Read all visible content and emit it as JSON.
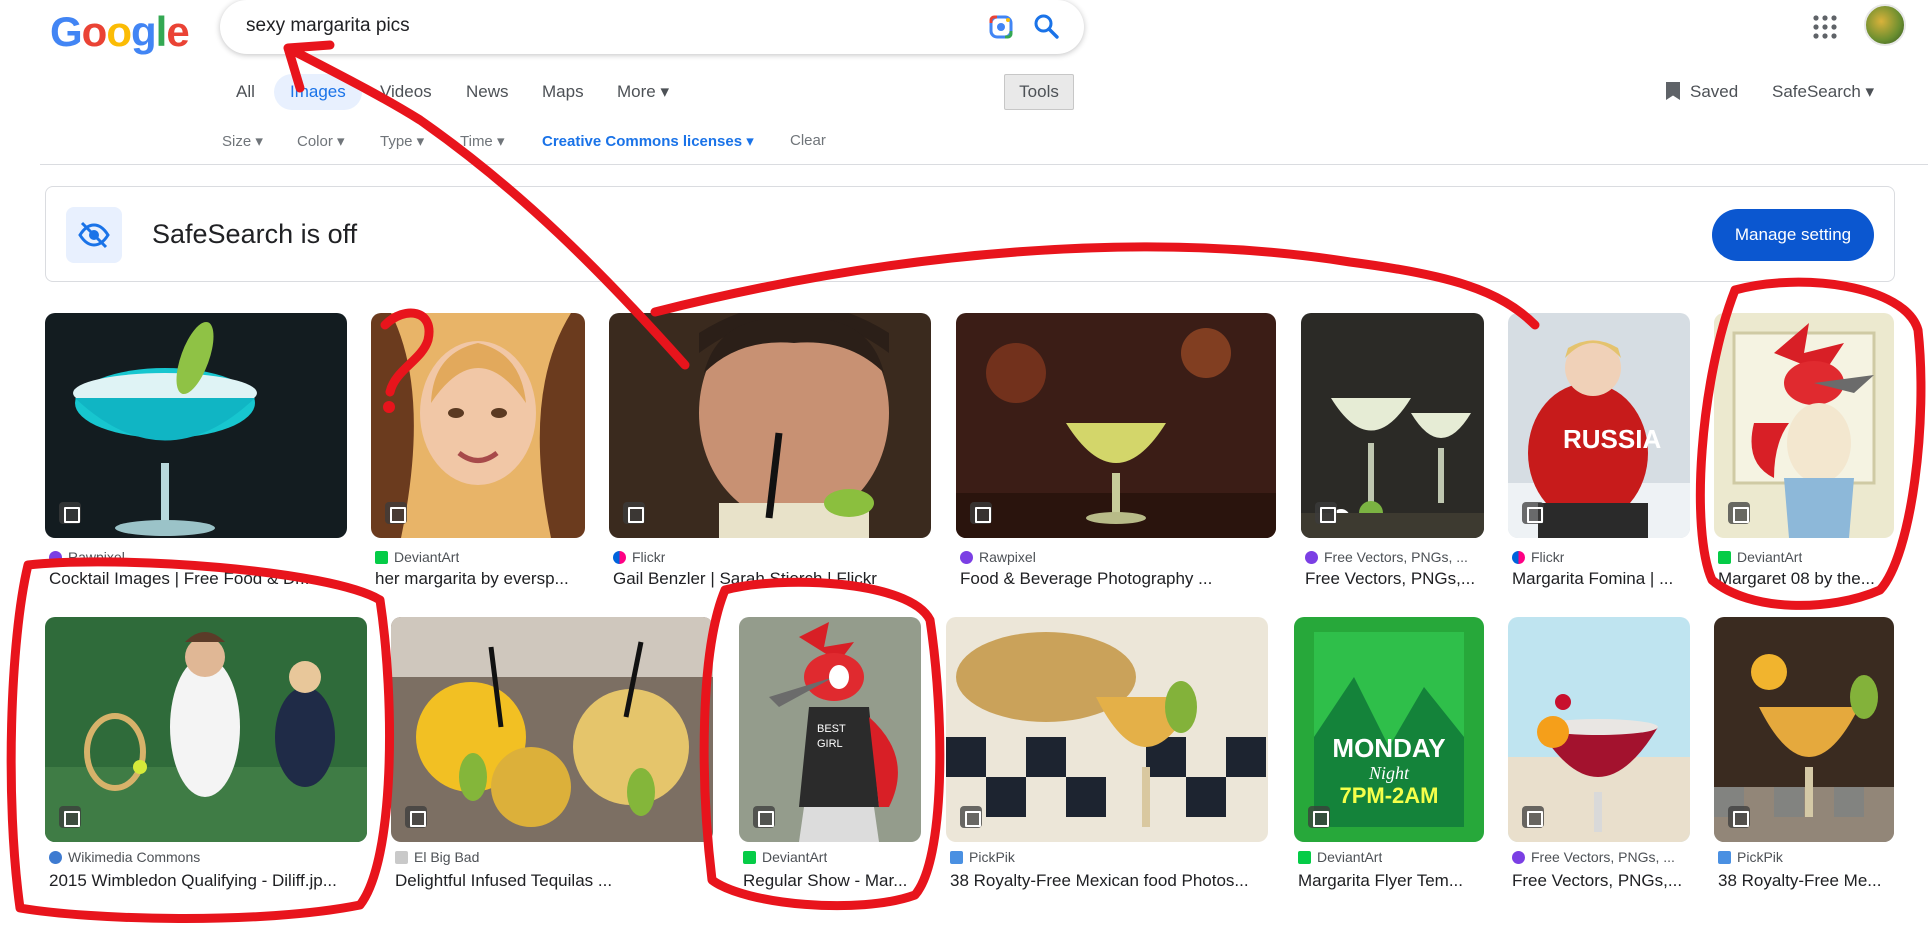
{
  "header": {
    "logo": "Google",
    "query": "sexy margarita pics"
  },
  "tabs": [
    "All",
    "Images",
    "Videos",
    "News",
    "Maps",
    "More ▾"
  ],
  "tools_label": "Tools",
  "saved_label": "Saved",
  "safesearch_label": "SafeSearch ▾",
  "filters": [
    "Size ▾",
    "Color ▾",
    "Type ▾",
    "Time ▾",
    "Creative Commons licenses ▾",
    "Clear"
  ],
  "banner": {
    "title": "SafeSearch is off",
    "button": "Manage setting"
  },
  "results": [
    {
      "source": "Rawpixel",
      "title": "Cocktail Images | Free Food & Dr..."
    },
    {
      "source": "DeviantArt",
      "title": "her margarita by eversp..."
    },
    {
      "source": "Flickr",
      "title": "Gail Benzler | Sarah Stierch | Flickr"
    },
    {
      "source": "Rawpixel",
      "title": "Food & Beverage Photography ..."
    },
    {
      "source": "Free Vectors, PNGs, ...",
      "title": "Free Vectors, PNGs,..."
    },
    {
      "source": "Flickr",
      "title": "Margarita Fomina | ..."
    },
    {
      "source": "DeviantArt",
      "title": "Margaret 08 by the..."
    },
    {
      "source": "Wikimedia Commons",
      "title": "2015 Wimbledon Qualifying - Diliff.jp..."
    },
    {
      "source": "El Big Bad",
      "title": "Delightful Infused Tequilas ..."
    },
    {
      "source": "DeviantArt",
      "title": "Regular Show - Mar..."
    },
    {
      "source": "PickPik",
      "title": "38 Royalty-Free Mexican food Photos..."
    },
    {
      "source": "DeviantArt",
      "title": "Margarita Flyer Tem..."
    },
    {
      "source": "Free Vectors, PNGs, ...",
      "title": "Free Vectors, PNGs,..."
    },
    {
      "source": "PickPik",
      "title": "38 Royalty-Free Me..."
    }
  ],
  "flyer_text": [
    "MONDAY",
    "Night",
    "7PM-2AM"
  ],
  "shirt_text": "RUSSIA",
  "annotation_text": "?",
  "colors": {
    "accent": "#1a73e8",
    "button": "#0b57d0",
    "annotation": "#e8141c"
  },
  "icons": [
    "google-lens-icon",
    "search-icon",
    "apps-grid-icon",
    "bookmark-icon",
    "eye-off-icon",
    "image-badge-icon"
  ]
}
